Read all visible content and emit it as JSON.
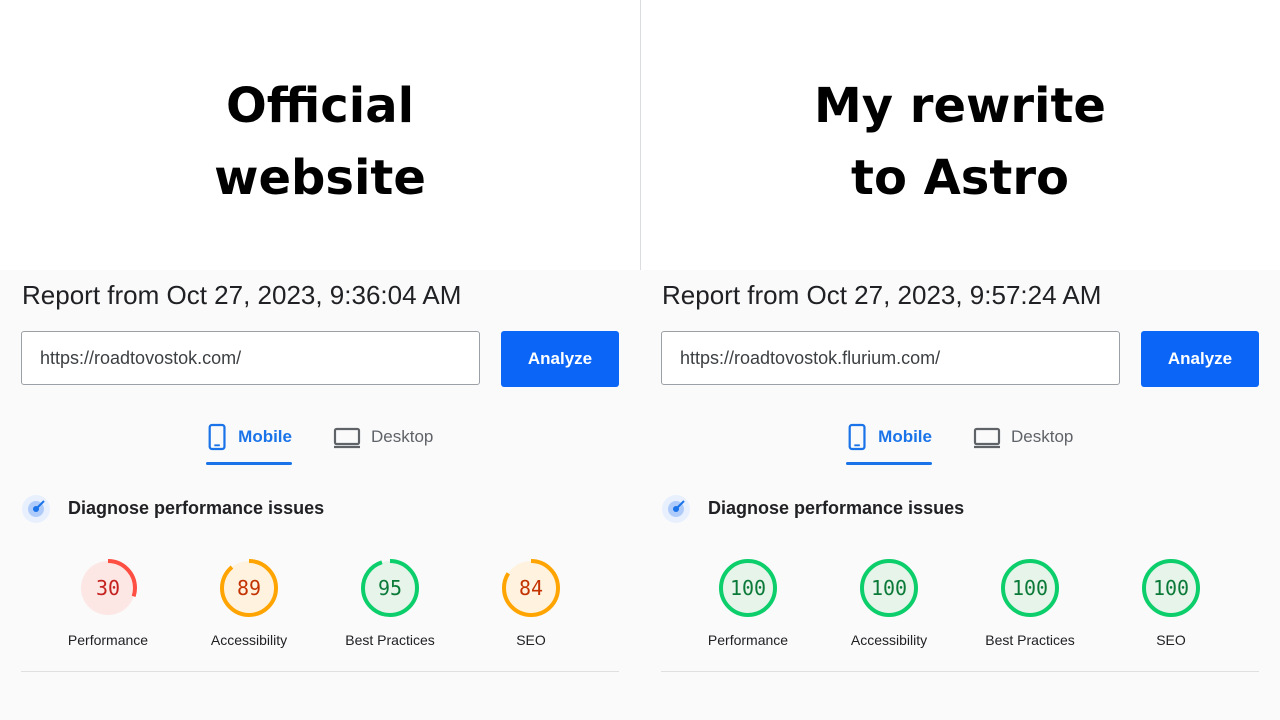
{
  "left": {
    "heading_line1": "Official",
    "heading_line2": "website",
    "report_title": "Report from Oct 27, 2023, 9:36:04 AM",
    "url_value": "https://roadtovostok.com/",
    "analyze_label": "Analyze",
    "tabs": {
      "mobile": "Mobile",
      "desktop": "Desktop",
      "selected": "Mobile"
    },
    "diagnose_label": "Diagnose performance issues",
    "scores": [
      {
        "label": "Performance",
        "value": "30",
        "color": "#ff4e42",
        "bg": "#fde7e5",
        "text_color": "#c5221f"
      },
      {
        "label": "Accessibility",
        "value": "89",
        "color": "#ffa400",
        "bg": "#fff3e0",
        "text_color": "#c33300"
      },
      {
        "label": "Best Practices",
        "value": "95",
        "color": "#0cce6b",
        "bg": "#e6f4ea",
        "text_color": "#0b7a38"
      },
      {
        "label": "SEO",
        "value": "84",
        "color": "#ffa400",
        "bg": "#fff3e0",
        "text_color": "#c33300"
      }
    ]
  },
  "right": {
    "heading_line1": "My rewrite",
    "heading_line2": "to Astro",
    "report_title": "Report from Oct 27, 2023, 9:57:24 AM",
    "url_value": "https://roadtovostok.flurium.com/",
    "analyze_label": "Analyze",
    "tabs": {
      "mobile": "Mobile",
      "desktop": "Desktop",
      "selected": "Mobile"
    },
    "diagnose_label": "Diagnose performance issues",
    "scores": [
      {
        "label": "Performance",
        "value": "100",
        "color": "#0cce6b",
        "bg": "#e6f4ea",
        "text_color": "#0b7a38"
      },
      {
        "label": "Accessibility",
        "value": "100",
        "color": "#0cce6b",
        "bg": "#e6f4ea",
        "text_color": "#0b7a38"
      },
      {
        "label": "Best Practices",
        "value": "100",
        "color": "#0cce6b",
        "bg": "#e6f4ea",
        "text_color": "#0b7a38"
      },
      {
        "label": "SEO",
        "value": "100",
        "color": "#0cce6b",
        "bg": "#e6f4ea",
        "text_color": "#0b7a38"
      }
    ]
  }
}
